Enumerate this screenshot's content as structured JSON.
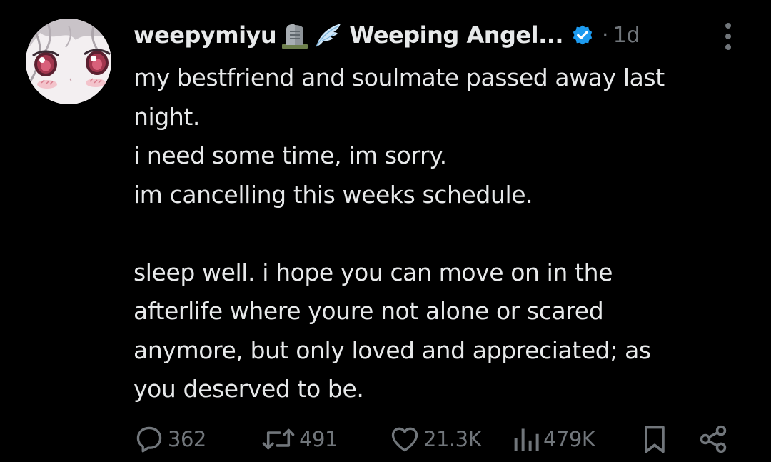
{
  "tweet": {
    "username": "weepymiyu",
    "display_name": "Weeping Angel...",
    "separator": "·",
    "time": "1d",
    "lines": [
      "my bestfriend and soulmate passed away last",
      "night.",
      "i need some time, im sorry.",
      "im cancelling this weeks schedule.",
      "",
      "sleep well. i hope you can move on in the",
      "afterlife where youre not alone or scared",
      "anymore, but only loved and appreciated; as",
      "you deserved to be."
    ]
  },
  "actions": {
    "replies": "362",
    "reposts": "491",
    "likes": "21.3K",
    "views": "479K"
  },
  "icons": {
    "emoji_1": "headstone-icon",
    "emoji_2": "wing-icon",
    "verified": "verified-badge-icon",
    "more": "more-options-icon",
    "reply": "reply-icon",
    "repost": "repost-icon",
    "like": "heart-icon",
    "views": "views-icon",
    "bookmark": "bookmark-icon",
    "share": "share-icon"
  },
  "colors": {
    "background": "#000000",
    "text": "#e7e9ea",
    "muted": "#71767b",
    "verified": "#1d9bf0"
  }
}
